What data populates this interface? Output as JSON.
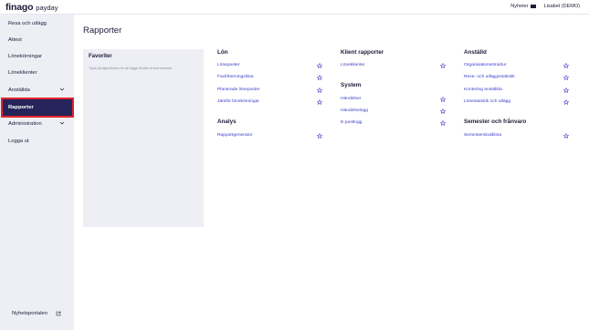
{
  "topbar": {
    "brand_name": "finago",
    "brand_sub": "payday",
    "news_label": "Nyheter",
    "user_label": "Lisabet (DEMO)"
  },
  "sidebar": {
    "items": [
      {
        "label": "Resa och utlägg"
      },
      {
        "label": "Attest"
      },
      {
        "label": "Lönekörningar"
      },
      {
        "label": "Löneklienter"
      },
      {
        "label": "Anställda"
      },
      {
        "label": "Rapporter"
      },
      {
        "label": "Administration"
      },
      {
        "label": "Logga ut"
      }
    ],
    "footer_label": "Nyhetsportalen"
  },
  "main": {
    "title": "Rapporter",
    "favorites": {
      "title": "Favoriter",
      "hint": "Tryck på stjärnikonen för att lägga till eller ta bort favoriter."
    },
    "sections": {
      "lon": {
        "title": "Lön",
        "links": [
          "Löneposter",
          "Fackföreningslista",
          "Planerade löneposter",
          "Jämför lönekörningar"
        ]
      },
      "analys": {
        "title": "Analys",
        "links": [
          "Rapportgenerator"
        ]
      },
      "klient": {
        "title": "Klient rapporter",
        "links": [
          "Löneklienter"
        ]
      },
      "system": {
        "title": "System",
        "links": [
          "Händelser",
          "Händelselogg",
          "E-postlogg"
        ]
      },
      "anstalld": {
        "title": "Anställd",
        "links": [
          "Organisationsstruktur",
          "Rese- och utläggsstatistik",
          "Kontering anställda",
          "Lönestatistik och utlägg"
        ]
      },
      "semester": {
        "title": "Semester och frånvaro",
        "links": [
          "Semesterskuldlista"
        ]
      }
    }
  },
  "colors": {
    "sidebar_bg": "#eeeef5",
    "active_item_bg": "#24245a",
    "active_outline": "#e0242c",
    "link": "#3b3bc8",
    "star": "#3b3bc8"
  }
}
